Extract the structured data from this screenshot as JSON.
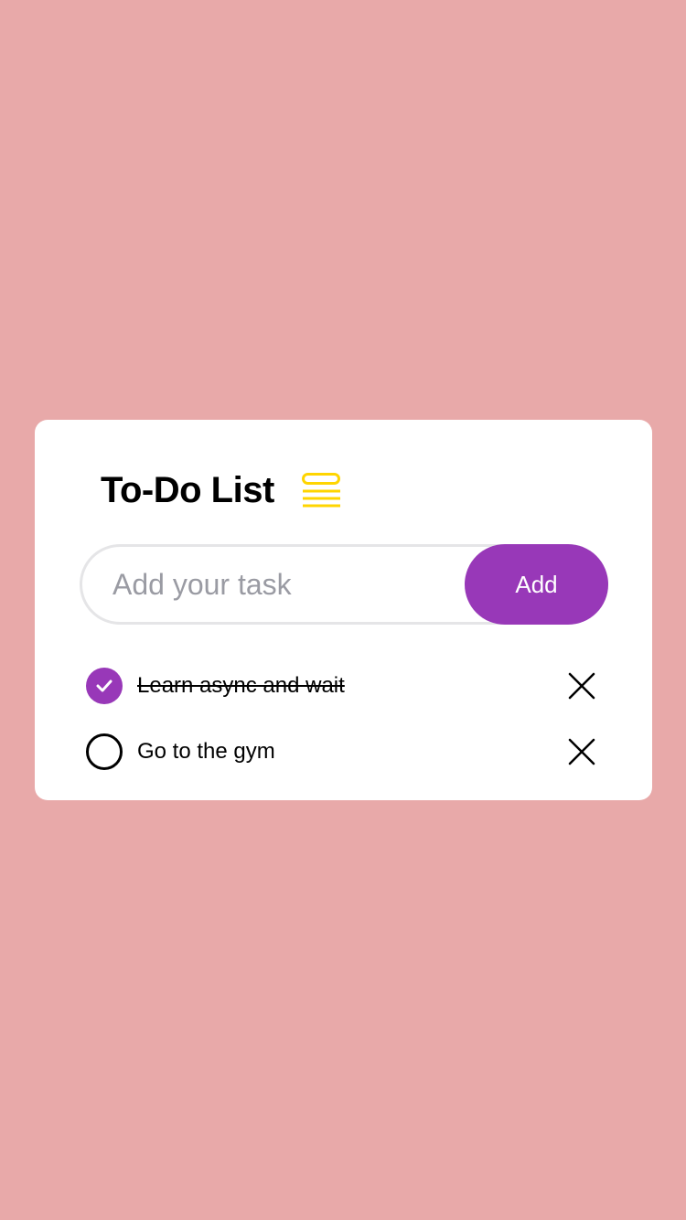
{
  "header": {
    "title": "To-Do List",
    "icon": "list-icon",
    "icon_color": "#ffd500"
  },
  "input": {
    "placeholder": "Add your task",
    "value": ""
  },
  "add_button": {
    "label": "Add",
    "color": "#9838b8"
  },
  "todos": [
    {
      "text": "Learn async and wait",
      "completed": true
    },
    {
      "text": "Go to the gym",
      "completed": false
    }
  ],
  "colors": {
    "background": "#e8a9a9",
    "card": "#ffffff",
    "accent": "#9838b8"
  }
}
